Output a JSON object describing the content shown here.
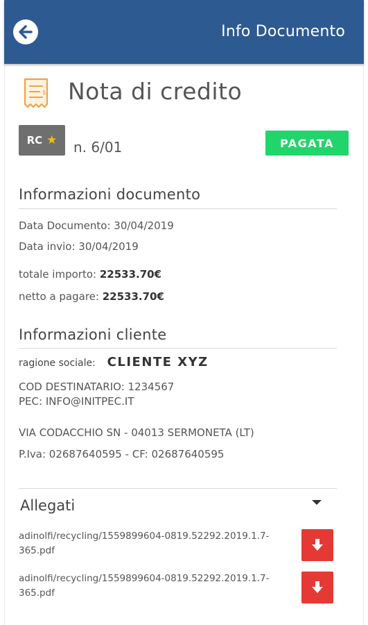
{
  "header": {
    "title": "Info Documento",
    "back_icon": "back-arrow-icon"
  },
  "document": {
    "type_icon": "receipt-icon",
    "title": "Nota di credito",
    "badge_text": "RC",
    "badge_icon": "star-icon",
    "number": "n. 6/01",
    "status": "PAGATA",
    "status_color": "#21d56a"
  },
  "doc_info": {
    "section_title": "Informazioni documento",
    "data_documento": "Data Documento: 30/04/2019",
    "data_invio": "Data invio: 30/04/2019",
    "totale_label": "totale importo:",
    "totale_value": "22533.70€",
    "netto_label": "netto a pagare:",
    "netto_value": "22533.70€"
  },
  "client_info": {
    "section_title": "Informazioni cliente",
    "ragione_label": "ragione sociale:",
    "ragione_value": "CLIENTE XYZ",
    "cod_destinatario": "COD DESTINATARIO: 1234567",
    "pec": "PEC: INFO@INITPEC.IT",
    "address": "VIA CODACCHIO SN - 04013 SERMONETA (LT)",
    "piva_cf": "P.Iva: 02687640595 - CF: 02687640595"
  },
  "attachments": {
    "section_title": "Allegati",
    "items": [
      {
        "name": "adinolfi/recycling/1559899604-0819.52292.2019.1.7-365.pdf"
      },
      {
        "name": "adinolfi/recycling/1559899604-0819.52292.2019.1.7-365.pdf"
      }
    ]
  },
  "colors": {
    "header_bg": "#2e5a92",
    "download_button": "#e53935",
    "badge_bg": "#6f6f6f"
  }
}
